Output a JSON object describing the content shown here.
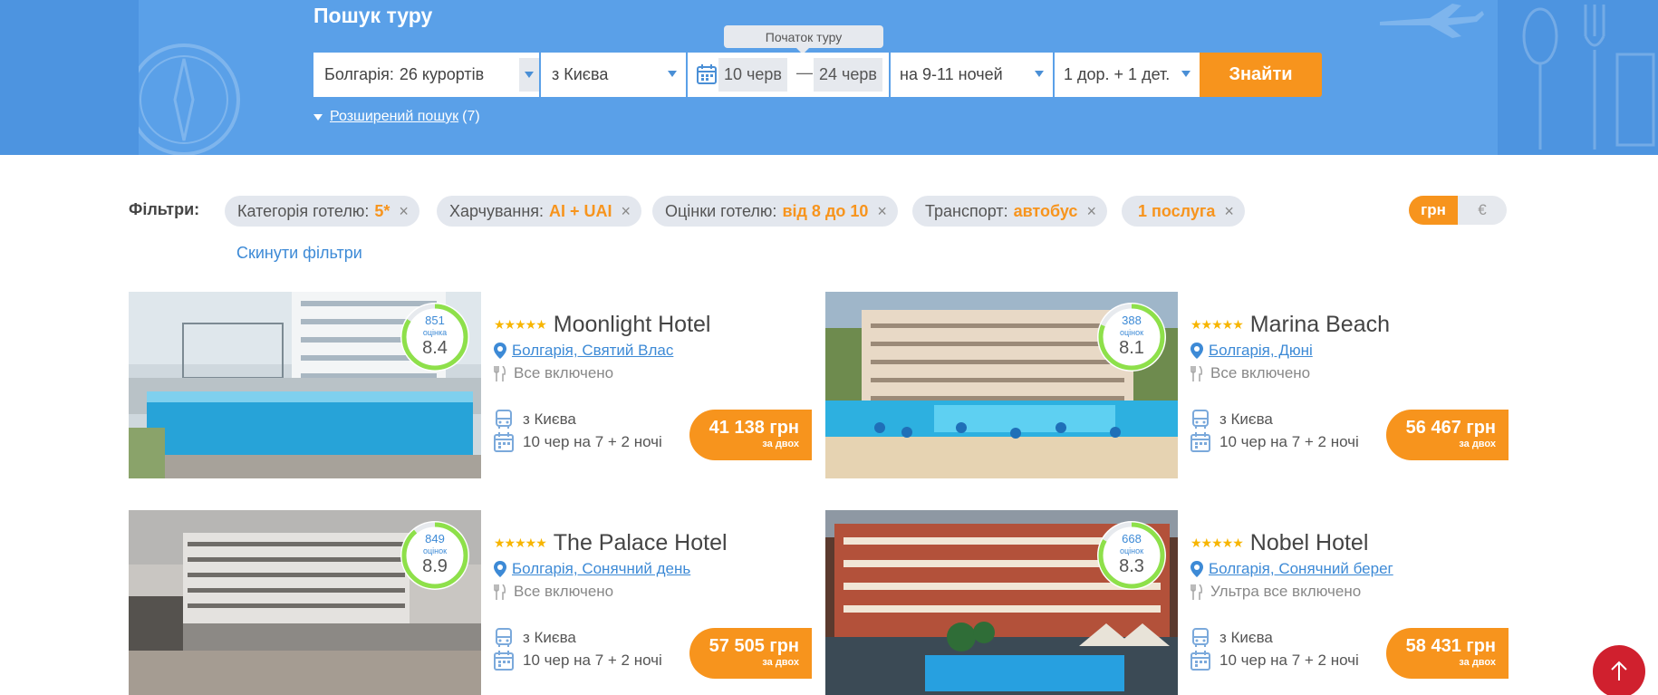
{
  "search": {
    "title": "Пошук туру",
    "country_label": "Болгарія:",
    "country_value": "26 курортів",
    "city": "з Києва",
    "tooltip": "Початок туру",
    "date_from": "10 черв",
    "date_dash": "—",
    "date_to": "24 черв",
    "nights": "на 9-11 ночей",
    "people": "1 дор. + 1 дет.",
    "find_button": "Знайти",
    "advanced_label": "Розширений пошук",
    "advanced_count": "(7)"
  },
  "filters": {
    "label": "Фільтри:",
    "chips": [
      {
        "name": "Категорія готелю:",
        "value": "5*"
      },
      {
        "name": "Харчування:",
        "value": "AI + UAI"
      },
      {
        "name": "Оцінки готелю:",
        "value": "від 8 до 10"
      },
      {
        "name": "Транспорт:",
        "value": "автобус"
      },
      {
        "name": "",
        "value": "1 послуга"
      }
    ],
    "remove_glyph": "×",
    "reset": "Скинути фільтри"
  },
  "currency": {
    "active": "грн",
    "inactive": "€"
  },
  "hotels": [
    {
      "stars": "★★★★★",
      "name": "Moonlight Hotel",
      "location": "Болгарія, Святий Влас",
      "meal": "Все включено",
      "from": "з Києва",
      "dates": "10 чер на 7 + 2 ночі",
      "price": "41 138 грн",
      "price_note": "за двох",
      "reviews": "851",
      "reviews_label": "оцінка",
      "score": "8.4",
      "score_fraction": 0.84
    },
    {
      "stars": "★★★★★",
      "name": "Marina Beach",
      "location": "Болгарія, Дюні",
      "meal": "Все включено",
      "from": "з Києва",
      "dates": "10 чер на 7 + 2 ночі",
      "price": "56 467 грн",
      "price_note": "за двох",
      "reviews": "388",
      "reviews_label": "оцінок",
      "score": "8.1",
      "score_fraction": 0.81
    },
    {
      "stars": "★★★★★",
      "name": "The Palace Hotel",
      "location": "Болгарія, Сонячний день",
      "meal": "Все включено",
      "from": "з Києва",
      "dates": "10 чер на 7 + 2 ночі",
      "price": "57 505 грн",
      "price_note": "за двох",
      "reviews": "849",
      "reviews_label": "оцінок",
      "score": "8.9",
      "score_fraction": 0.89
    },
    {
      "stars": "★★★★★",
      "name": "Nobel Hotel",
      "location": "Болгарія, Сонячний берег",
      "meal": "Ультра все включено",
      "from": "з Києва",
      "dates": "10 чер на 7 + 2 ночі",
      "price": "58 431 грн",
      "price_note": "за двох",
      "reviews": "668",
      "reviews_label": "оцінок",
      "score": "8.3",
      "score_fraction": 0.83
    }
  ],
  "colors": {
    "accent": "#f7941d",
    "hero": "#5aa0e8",
    "link": "#3d8ad6",
    "rating_ring": "#8ee04a",
    "scroll_top": "#d0202e"
  },
  "icons": [
    "calendar-icon",
    "location-pin-icon",
    "fork-knife-icon",
    "bus-icon",
    "compass-icon",
    "airplane-icon",
    "arrow-up-icon",
    "close-icon"
  ]
}
